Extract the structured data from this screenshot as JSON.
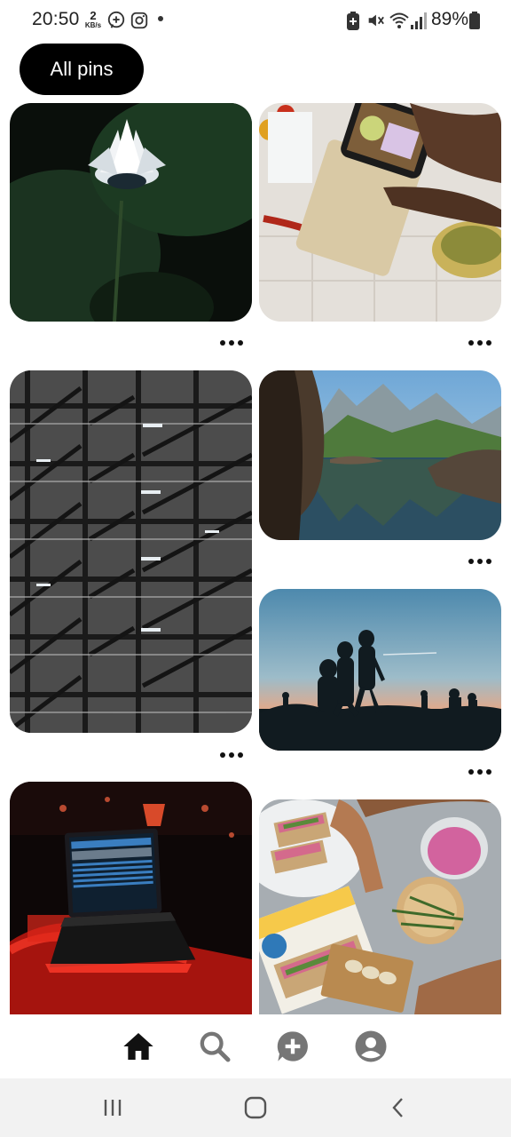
{
  "status_bar": {
    "time": "20:50",
    "net_speed_value": "2",
    "net_speed_unit": "KB/s",
    "battery_percent": "89%",
    "icons": [
      "messenger-icon",
      "instagram-icon",
      "notification-dot",
      "battery-saver-icon",
      "mute-icon",
      "wifi-icon",
      "signal-icon",
      "battery-icon"
    ]
  },
  "filter": {
    "chip_label": "All pins"
  },
  "pins": [
    {
      "name": "pin-water-lily",
      "subject": "white water lily on dark leaves",
      "more_icon": "more-options-icon"
    },
    {
      "name": "pin-phone-food",
      "subject": "phone photographing food on table",
      "more_icon": "more-options-icon"
    },
    {
      "name": "pin-stairs-building",
      "subject": "black and white stairwell structure",
      "more_icon": "more-options-icon"
    },
    {
      "name": "pin-mountain-lake",
      "subject": "mountain lake reflection",
      "more_icon": "more-options-icon"
    },
    {
      "name": "pin-hikers-sunset",
      "subject": "hikers silhouettes at sunset",
      "more_icon": "more-options-icon"
    },
    {
      "name": "pin-dj-laptop",
      "subject": "dj laptop on red lit stage",
      "more_icon": "more-options-icon"
    },
    {
      "name": "pin-crispbread",
      "subject": "crispbread snacks with spreads",
      "more_icon": "more-options-icon"
    }
  ],
  "tabbar": {
    "items": [
      "home-icon",
      "search-icon",
      "create-icon",
      "profile-icon"
    ],
    "active": "home-icon",
    "active_color": "#111111",
    "inactive_color": "#767676"
  },
  "system_nav": [
    "recents-icon",
    "home-button-icon",
    "back-icon"
  ]
}
